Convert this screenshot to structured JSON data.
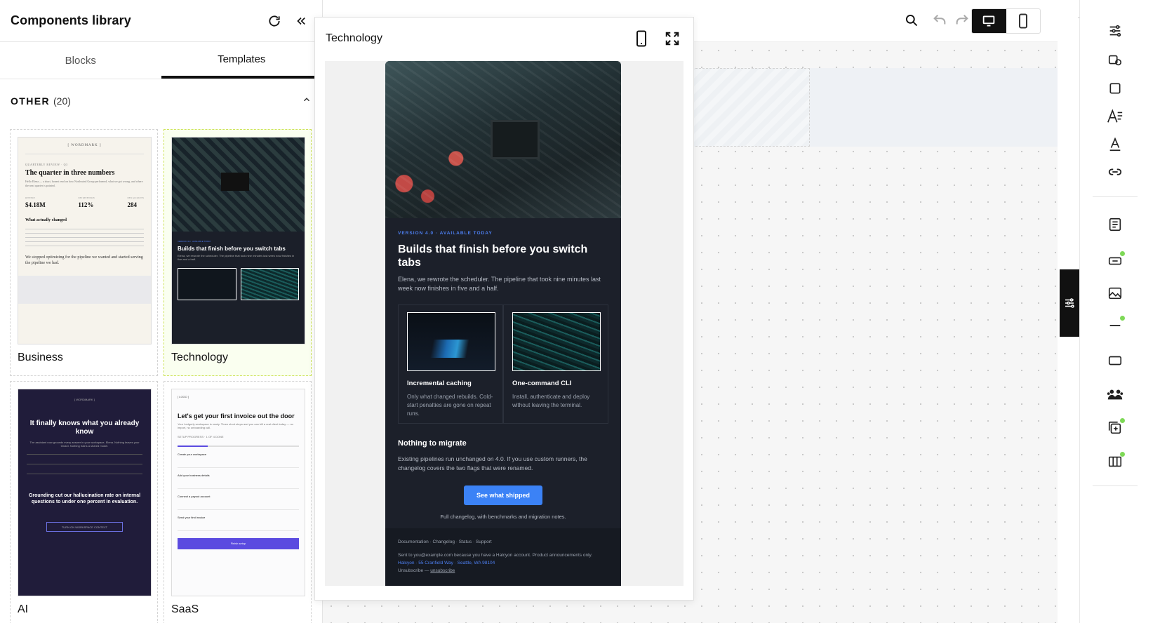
{
  "panel": {
    "title": "Components library",
    "tabs": [
      "Blocks",
      "Templates"
    ],
    "section_title": "OTHER",
    "section_count": "(20)"
  },
  "templates": [
    {
      "name": "Business",
      "thumb": {
        "wordmark": "[ WORDMARK ]",
        "eyebrow": "QUARTERLY REVIEW · Q3",
        "title": "The quarter in three numbers",
        "intro": "Hello Elena — a short, honest read on how Northwind Group performed, what we got wrong, and where the next quarter is pointed.",
        "nums": [
          {
            "l": "REVENUE",
            "v": "$4.18M"
          },
          {
            "l": "NET RETENTION",
            "v": "112%"
          },
          {
            "l": "NEW ACCOUNTS",
            "v": "284"
          }
        ],
        "h": "What actually changed",
        "quote": "We stopped optimizing for the pipeline we wanted and started serving the pipeline we had."
      }
    },
    {
      "name": "Technology",
      "thumb": {
        "tag": "VERSION 4.0 · AVAILABLE TODAY",
        "title": "Builds that finish before you switch tabs",
        "lead": "Elena, we rewrote the scheduler. The pipeline that took nine minutes last week now finishes in five and a half."
      }
    },
    {
      "name": "AI",
      "thumb": {
        "wordmark": "[ WORDMARK ]",
        "title": "It finally knows what you already know",
        "lead": "The assistant now grounds every answer in your workspace, Elena. Nothing leaves your tenant. Nothing trains a shared model.",
        "callout": "Grounding cut our hallucination rate on internal questions to under one percent in evaluation.",
        "button": "TURN ON WORKSPACE CONTEXT"
      }
    },
    {
      "name": "SaaS",
      "thumb": {
        "logo": "[ LOGO ]",
        "title": "Let's get your first invoice out the door",
        "lead": "Your Ledgerly workspace is ready. Three short steps and you can bill a real client today — no import, no onboarding call.",
        "progress": "SETUP PROGRESS · 1 OF 4 DONE",
        "progress_value": 0.25,
        "steps": [
          "Create your workspace",
          "Add your business details",
          "Connect a payout account",
          "Send your first invoice"
        ],
        "button": "Finish setup"
      }
    }
  ],
  "preview": {
    "title": "Technology",
    "email": {
      "tag": "VERSION 4.0 · AVAILABLE TODAY",
      "headline": "Builds that finish before you switch tabs",
      "lead": "Elena, we rewrote the scheduler. The pipeline that took nine minutes last week now finishes in five and a half.",
      "features": [
        {
          "title": "Incremental caching",
          "text": "Only what changed rebuilds. Cold-start penalties are gone on repeat runs."
        },
        {
          "title": "One-command CLI",
          "text": "Install, authenticate and deploy without leaving the terminal."
        }
      ],
      "section_title": "Nothing to migrate",
      "section_text": "Existing pipelines run unchanged on 4.0. If you use custom runners, the changelog covers the two flags that were renamed.",
      "cta": "See what shipped",
      "cta_note": "Full changelog, with benchmarks and migration notes.",
      "footer_links": "Documentation · Changelog · Status · Support",
      "footer_sent": "Sent to you@example.com because you have a Halcyon account. Product announcements only.",
      "footer_address": "Halcyon · 55 Cranfield Way · Seattle, WA 98104",
      "footer_unsub_prefix": "Unsubscribe — ",
      "footer_unsub_link": "unsubscribe"
    }
  },
  "colors": {
    "accent": "#3b82f6",
    "selected_border": "#cde45a",
    "email_bg": "#1c202a",
    "status_dot": "#7ed957"
  }
}
